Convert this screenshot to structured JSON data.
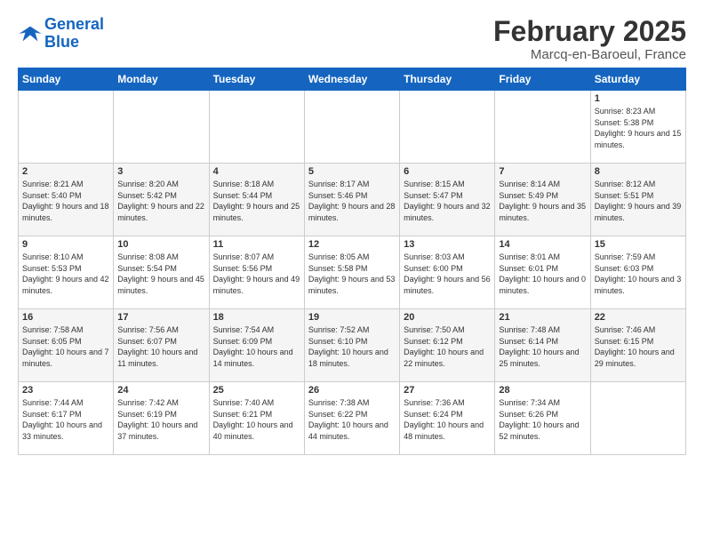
{
  "logo": {
    "line1": "General",
    "line2": "Blue"
  },
  "title": "February 2025",
  "subtitle": "Marcq-en-Baroeul, France",
  "headers": [
    "Sunday",
    "Monday",
    "Tuesday",
    "Wednesday",
    "Thursday",
    "Friday",
    "Saturday"
  ],
  "weeks": [
    [
      {
        "num": "",
        "info": ""
      },
      {
        "num": "",
        "info": ""
      },
      {
        "num": "",
        "info": ""
      },
      {
        "num": "",
        "info": ""
      },
      {
        "num": "",
        "info": ""
      },
      {
        "num": "",
        "info": ""
      },
      {
        "num": "1",
        "info": "Sunrise: 8:23 AM\nSunset: 5:38 PM\nDaylight: 9 hours and 15 minutes."
      }
    ],
    [
      {
        "num": "2",
        "info": "Sunrise: 8:21 AM\nSunset: 5:40 PM\nDaylight: 9 hours and 18 minutes."
      },
      {
        "num": "3",
        "info": "Sunrise: 8:20 AM\nSunset: 5:42 PM\nDaylight: 9 hours and 22 minutes."
      },
      {
        "num": "4",
        "info": "Sunrise: 8:18 AM\nSunset: 5:44 PM\nDaylight: 9 hours and 25 minutes."
      },
      {
        "num": "5",
        "info": "Sunrise: 8:17 AM\nSunset: 5:46 PM\nDaylight: 9 hours and 28 minutes."
      },
      {
        "num": "6",
        "info": "Sunrise: 8:15 AM\nSunset: 5:47 PM\nDaylight: 9 hours and 32 minutes."
      },
      {
        "num": "7",
        "info": "Sunrise: 8:14 AM\nSunset: 5:49 PM\nDaylight: 9 hours and 35 minutes."
      },
      {
        "num": "8",
        "info": "Sunrise: 8:12 AM\nSunset: 5:51 PM\nDaylight: 9 hours and 39 minutes."
      }
    ],
    [
      {
        "num": "9",
        "info": "Sunrise: 8:10 AM\nSunset: 5:53 PM\nDaylight: 9 hours and 42 minutes."
      },
      {
        "num": "10",
        "info": "Sunrise: 8:08 AM\nSunset: 5:54 PM\nDaylight: 9 hours and 45 minutes."
      },
      {
        "num": "11",
        "info": "Sunrise: 8:07 AM\nSunset: 5:56 PM\nDaylight: 9 hours and 49 minutes."
      },
      {
        "num": "12",
        "info": "Sunrise: 8:05 AM\nSunset: 5:58 PM\nDaylight: 9 hours and 53 minutes."
      },
      {
        "num": "13",
        "info": "Sunrise: 8:03 AM\nSunset: 6:00 PM\nDaylight: 9 hours and 56 minutes."
      },
      {
        "num": "14",
        "info": "Sunrise: 8:01 AM\nSunset: 6:01 PM\nDaylight: 10 hours and 0 minutes."
      },
      {
        "num": "15",
        "info": "Sunrise: 7:59 AM\nSunset: 6:03 PM\nDaylight: 10 hours and 3 minutes."
      }
    ],
    [
      {
        "num": "16",
        "info": "Sunrise: 7:58 AM\nSunset: 6:05 PM\nDaylight: 10 hours and 7 minutes."
      },
      {
        "num": "17",
        "info": "Sunrise: 7:56 AM\nSunset: 6:07 PM\nDaylight: 10 hours and 11 minutes."
      },
      {
        "num": "18",
        "info": "Sunrise: 7:54 AM\nSunset: 6:09 PM\nDaylight: 10 hours and 14 minutes."
      },
      {
        "num": "19",
        "info": "Sunrise: 7:52 AM\nSunset: 6:10 PM\nDaylight: 10 hours and 18 minutes."
      },
      {
        "num": "20",
        "info": "Sunrise: 7:50 AM\nSunset: 6:12 PM\nDaylight: 10 hours and 22 minutes."
      },
      {
        "num": "21",
        "info": "Sunrise: 7:48 AM\nSunset: 6:14 PM\nDaylight: 10 hours and 25 minutes."
      },
      {
        "num": "22",
        "info": "Sunrise: 7:46 AM\nSunset: 6:15 PM\nDaylight: 10 hours and 29 minutes."
      }
    ],
    [
      {
        "num": "23",
        "info": "Sunrise: 7:44 AM\nSunset: 6:17 PM\nDaylight: 10 hours and 33 minutes."
      },
      {
        "num": "24",
        "info": "Sunrise: 7:42 AM\nSunset: 6:19 PM\nDaylight: 10 hours and 37 minutes."
      },
      {
        "num": "25",
        "info": "Sunrise: 7:40 AM\nSunset: 6:21 PM\nDaylight: 10 hours and 40 minutes."
      },
      {
        "num": "26",
        "info": "Sunrise: 7:38 AM\nSunset: 6:22 PM\nDaylight: 10 hours and 44 minutes."
      },
      {
        "num": "27",
        "info": "Sunrise: 7:36 AM\nSunset: 6:24 PM\nDaylight: 10 hours and 48 minutes."
      },
      {
        "num": "28",
        "info": "Sunrise: 7:34 AM\nSunset: 6:26 PM\nDaylight: 10 hours and 52 minutes."
      },
      {
        "num": "",
        "info": ""
      }
    ]
  ]
}
